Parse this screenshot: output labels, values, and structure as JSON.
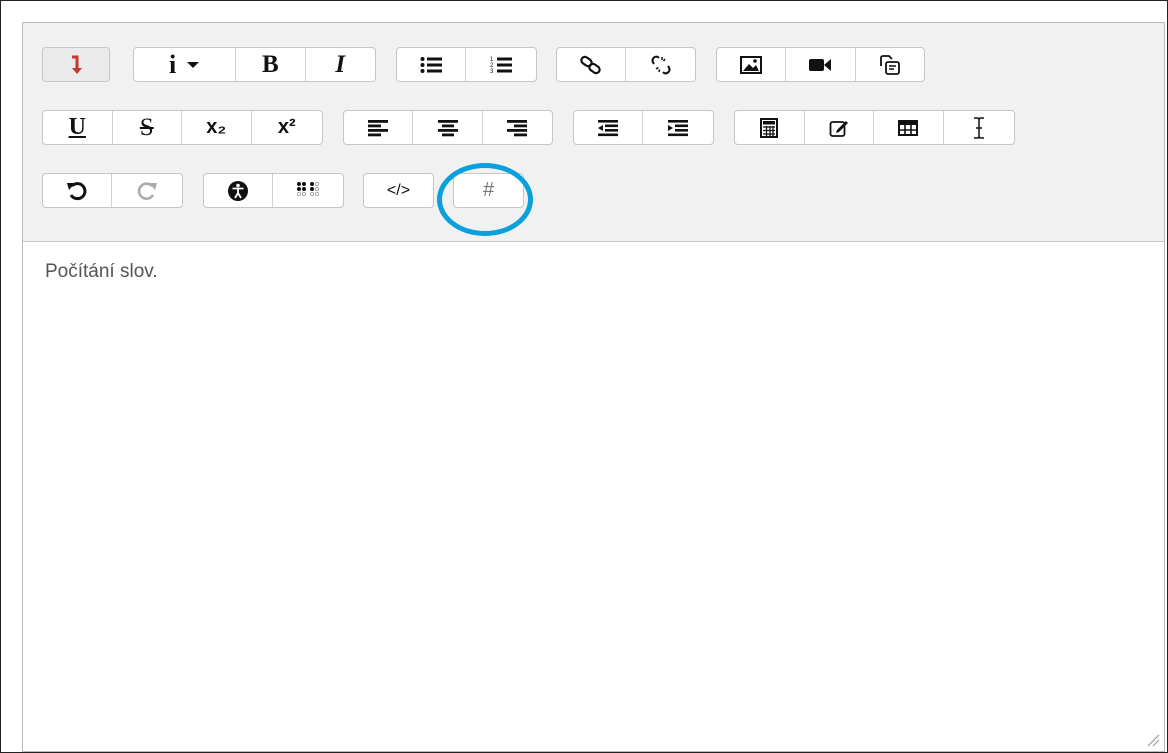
{
  "editor": {
    "content_text": "Počítání slov."
  },
  "toolbar": {
    "row1": {
      "collapse_icon": "arrow-down-red-icon",
      "info_label": "i",
      "bold_label": "B",
      "italic_label": "I",
      "icons": [
        "unordered-list-icon",
        "ordered-list-icon",
        "link-icon",
        "unlink-icon",
        "image-icon",
        "video-icon",
        "copy-icon"
      ]
    },
    "row2": {
      "underline_label": "U",
      "strike_label": "S",
      "subscript_label": "x₂",
      "superscript_label": "x²",
      "icons": [
        "align-left-icon",
        "align-center-icon",
        "align-right-icon",
        "outdent-icon",
        "indent-icon",
        "calculator-icon",
        "edit-icon",
        "table-icon",
        "text-cursor-icon"
      ]
    },
    "row3": {
      "html_label": "</>",
      "word_count_label": "#",
      "icons": [
        "undo-icon",
        "redo-icon",
        "accessibility-icon",
        "braille-icon"
      ]
    }
  },
  "colors": {
    "toolbar_bg": "#f1f1f1",
    "highlight": "#0aa0dd",
    "collapse_arrow": "#c0392b"
  }
}
